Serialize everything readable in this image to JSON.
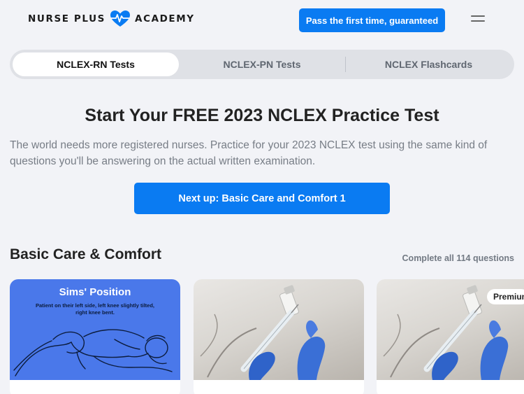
{
  "header": {
    "brand_left": "NURSE PLUS",
    "brand_right": "ACADEMY",
    "cta_label": "Pass the first time, guaranteed",
    "menu_icon": "hamburger-menu-icon"
  },
  "tabs": [
    {
      "label": "NCLEX-RN Tests",
      "active": true
    },
    {
      "label": "NCLEX-PN Tests",
      "active": false
    },
    {
      "label": "NCLEX Flashcards",
      "active": false
    }
  ],
  "hero": {
    "title": "Start Your FREE 2023 NCLEX Practice Test",
    "description": "The world needs more registered nurses. Practice for your 2023 NCLEX test using the same kind of questions you'll be answering on the actual written examination.",
    "next_button": "Next up: Basic Care and Comfort 1"
  },
  "section": {
    "title": "Basic Care & Comfort",
    "meta": "Complete all 114 questions"
  },
  "cards": [
    {
      "image_title": "Sims' Position",
      "image_subtitle": "Patient on their left side, left knee slightly tilted, right knee bent."
    },
    {
      "image": "syringe-photo"
    },
    {
      "image": "syringe-photo",
      "badge": "Premium"
    }
  ],
  "colors": {
    "accent": "#0a7bf2",
    "background": "#f2f3f7",
    "card_blue": "#4a78ea"
  }
}
